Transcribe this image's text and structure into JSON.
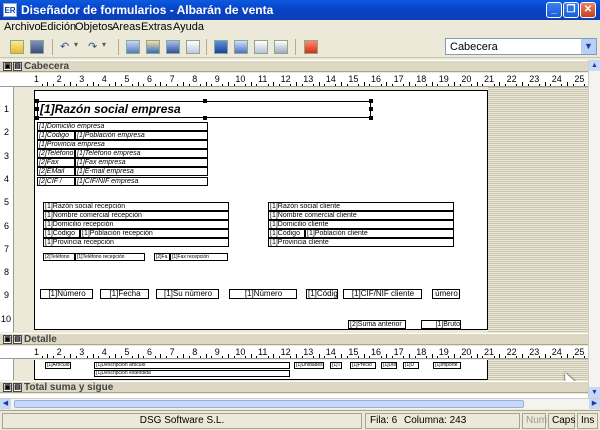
{
  "window": {
    "icon_label": "ER",
    "title": "Diseñador de formularios - Albarán de venta",
    "minimize": "_",
    "maximize": "❐",
    "close": "✕"
  },
  "menu": [
    "Archivo",
    "Edición",
    "Objetos",
    "Areas",
    "Extras",
    "Ayuda"
  ],
  "toolbar": {
    "section_value": "Cabecera"
  },
  "bands": {
    "cabecera": "Cabecera",
    "detalle": "Detalle",
    "total": "Total suma y sigue"
  },
  "ruler_h": [
    "1",
    "2",
    "3",
    "4",
    "5",
    "6",
    "7",
    "8",
    "9",
    "10",
    "11",
    "12",
    "13",
    "14",
    "15",
    "16",
    "17",
    "18",
    "19",
    "20",
    "21",
    "22",
    "23",
    "24",
    "25"
  ],
  "ruler_v": [
    "1",
    "2",
    "3",
    "4",
    "5",
    "6",
    "7",
    "8",
    "9",
    "10"
  ],
  "cabecera": {
    "title_field": "[1]Razón social empresa",
    "company": [
      "[1]Domicilio empresa",
      "[1]Código",
      "[1]Población empresa",
      "[1]Provincia empresa",
      "[2]Teléfono",
      "[1]Teléfono empresa",
      "[2]Fax",
      "[1]Fax empresa",
      "[2]EMail",
      "[1]E-mail empresa",
      "[2]CIF /",
      "[1]CIF/NIF empresa"
    ],
    "reception": [
      "[1]Razón social recepción",
      "[1]Nombre comercial recepción",
      "[1]Domicilio recepción",
      "[1]Código",
      "[1]Población recepción",
      "[1]Provincia recepción"
    ],
    "client": [
      "[1]Razón social cliente",
      "[1]Nombre comercial cliente",
      "[1]Domicilio cliente",
      "[1]Código",
      "[1]Población cliente",
      "[1]Provincia cliente"
    ],
    "phone_row": [
      "[2]Teléfono",
      "[1]Teléfono recepción",
      "[2]Fa",
      "[1]Fax recepción"
    ],
    "doc_row": [
      "[1]Número",
      "[1]Fecha",
      "[1]Su número",
      "[1]Número",
      "[1]Código",
      "[1]CIF/NIF cliente",
      "úmero"
    ],
    "bottom_row": [
      "[2]Suma anterior",
      "[1]Bruto"
    ]
  },
  "detalle": {
    "row1": [
      "[1]Artículo",
      "[1]Descripción artículo",
      "[1]Unidades",
      "[1]T",
      "[1]Precio",
      "[1]Dto.",
      "[1]U",
      "[1]Importe"
    ],
    "row2": [
      "[1]Descripción extendida"
    ]
  },
  "status": {
    "company": "DSG Software S.L.",
    "row": "Fila: 6",
    "column": "Columna: 243",
    "num": "Num",
    "caps": "Caps",
    "ins": "Ins"
  }
}
